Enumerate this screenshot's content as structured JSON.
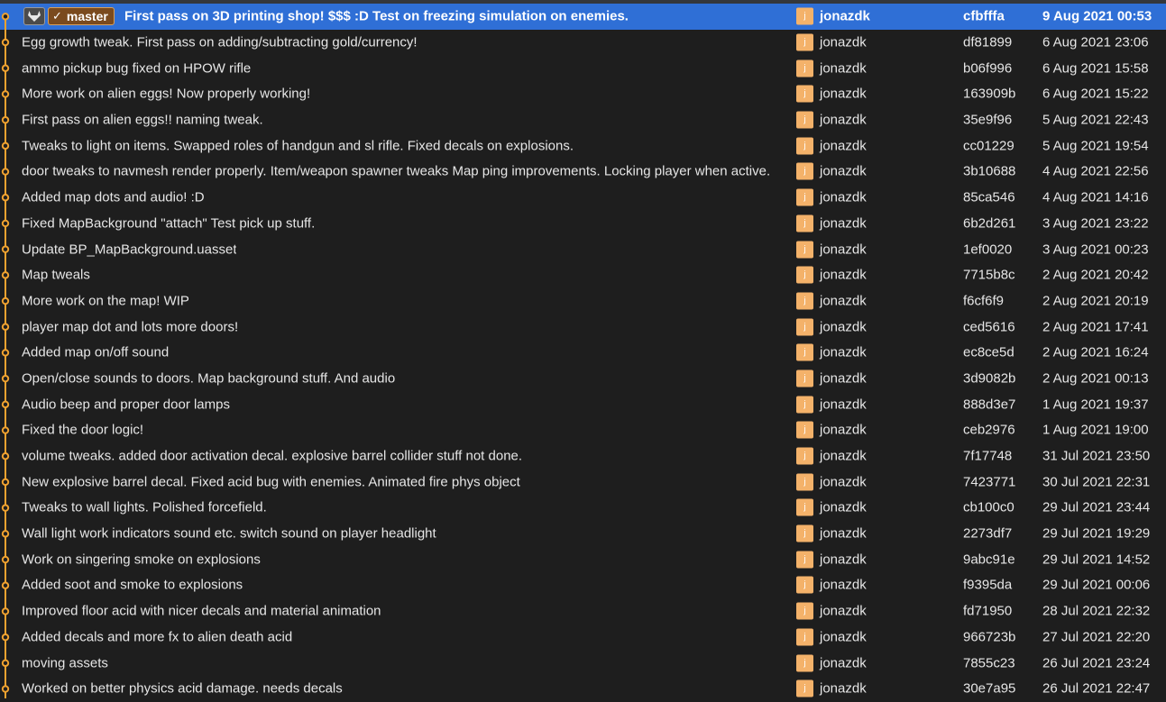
{
  "colors": {
    "background": "#1e1e1e",
    "selected": "#2f6fd6",
    "graph_line": "#f0a230",
    "avatar": "#f4b26a",
    "branch_badge": "#7a4a1e"
  },
  "head": {
    "branch": "master",
    "check_icon": "check-icon",
    "vcs_icon": "gitlab-icon"
  },
  "commits": [
    {
      "message": "First pass on 3D printing shop! $$$ :D  Test on freezing simulation on enemies.",
      "avatar": "j",
      "author": "jonazdk",
      "hash": "cfbfffa",
      "date": "9 Aug 2021 00:53"
    },
    {
      "message": "Egg growth tweak. First pass on adding/subtracting gold/currency!",
      "avatar": "j",
      "author": "jonazdk",
      "hash": "df81899",
      "date": "6 Aug 2021 23:06"
    },
    {
      "message": "ammo pickup bug fixed on HPOW rifle",
      "avatar": "j",
      "author": "jonazdk",
      "hash": "b06f996",
      "date": "6 Aug 2021 15:58"
    },
    {
      "message": "More work on alien eggs! Now properly working!",
      "avatar": "j",
      "author": "jonazdk",
      "hash": "163909b",
      "date": "6 Aug 2021 15:22"
    },
    {
      "message": "First pass on alien eggs!!  naming tweak.",
      "avatar": "j",
      "author": "jonazdk",
      "hash": "35e9f96",
      "date": "5 Aug 2021 22:43"
    },
    {
      "message": "Tweaks to light on items. Swapped roles of handgun and sl rifle. Fixed decals on explosions.",
      "avatar": "j",
      "author": "jonazdk",
      "hash": "cc01229",
      "date": "5 Aug 2021 19:54"
    },
    {
      "message": "door tweaks to navmesh render properly. Item/weapon spawner tweaks Map ping improvements. Locking player when active.",
      "avatar": "j",
      "author": "jonazdk",
      "hash": "3b10688",
      "date": "4 Aug 2021 22:56"
    },
    {
      "message": "Added map dots and audio! :D",
      "avatar": "j",
      "author": "jonazdk",
      "hash": "85ca546",
      "date": "4 Aug 2021 14:16"
    },
    {
      "message": "Fixed MapBackground \"attach\"  Test pick up stuff.",
      "avatar": "j",
      "author": "jonazdk",
      "hash": "6b2d261",
      "date": "3 Aug 2021 23:22"
    },
    {
      "message": "Update BP_MapBackground.uasset",
      "avatar": "j",
      "author": "jonazdk",
      "hash": "1ef0020",
      "date": "3 Aug 2021 00:23"
    },
    {
      "message": "Map tweals",
      "avatar": "j",
      "author": "jonazdk",
      "hash": "7715b8c",
      "date": "2 Aug 2021 20:42"
    },
    {
      "message": "More work on the map! WIP",
      "avatar": "j",
      "author": "jonazdk",
      "hash": "f6cf6f9",
      "date": "2 Aug 2021 20:19"
    },
    {
      "message": "player map dot and lots more doors!",
      "avatar": "j",
      "author": "jonazdk",
      "hash": "ced5616",
      "date": "2 Aug 2021 17:41"
    },
    {
      "message": "Added map on/off sound",
      "avatar": "j",
      "author": "jonazdk",
      "hash": "ec8ce5d",
      "date": "2 Aug 2021 16:24"
    },
    {
      "message": "Open/close sounds to doors. Map background stuff. And audio",
      "avatar": "j",
      "author": "jonazdk",
      "hash": "3d9082b",
      "date": "2 Aug 2021 00:13"
    },
    {
      "message": "Audio beep and proper door lamps",
      "avatar": "j",
      "author": "jonazdk",
      "hash": "888d3e7",
      "date": "1 Aug 2021 19:37"
    },
    {
      "message": "Fixed the door logic!",
      "avatar": "j",
      "author": "jonazdk",
      "hash": "ceb2976",
      "date": "1 Aug 2021 19:00"
    },
    {
      "message": "volume tweaks. added door activation decal.  explosive barrel collider stuff not done.",
      "avatar": "j",
      "author": "jonazdk",
      "hash": "7f17748",
      "date": "31 Jul 2021 23:50"
    },
    {
      "message": "New explosive barrel decal. Fixed acid bug with enemies. Animated fire phys object",
      "avatar": "j",
      "author": "jonazdk",
      "hash": "7423771",
      "date": "30 Jul 2021 22:31"
    },
    {
      "message": "Tweaks to wall lights. Polished forcefield.",
      "avatar": "j",
      "author": "jonazdk",
      "hash": "cb100c0",
      "date": "29 Jul 2021 23:44"
    },
    {
      "message": "Wall light work indicators sound etc. switch sound on player headlight",
      "avatar": "j",
      "author": "jonazdk",
      "hash": "2273df7",
      "date": "29 Jul 2021 19:29"
    },
    {
      "message": "Work on singering smoke on explosions",
      "avatar": "j",
      "author": "jonazdk",
      "hash": "9abc91e",
      "date": "29 Jul 2021 14:52"
    },
    {
      "message": "Added soot and smoke to explosions",
      "avatar": "j",
      "author": "jonazdk",
      "hash": "f9395da",
      "date": "29 Jul 2021 00:06"
    },
    {
      "message": "Improved floor acid with nicer decals and material animation",
      "avatar": "j",
      "author": "jonazdk",
      "hash": "fd71950",
      "date": "28 Jul 2021 22:32"
    },
    {
      "message": "Added decals and more fx to alien death acid",
      "avatar": "j",
      "author": "jonazdk",
      "hash": "966723b",
      "date": "27 Jul 2021 22:20"
    },
    {
      "message": "moving assets",
      "avatar": "j",
      "author": "jonazdk",
      "hash": "7855c23",
      "date": "26 Jul 2021 23:24"
    },
    {
      "message": "Worked on better physics acid damage. needs decals",
      "avatar": "j",
      "author": "jonazdk",
      "hash": "30e7a95",
      "date": "26 Jul 2021 22:47"
    }
  ]
}
